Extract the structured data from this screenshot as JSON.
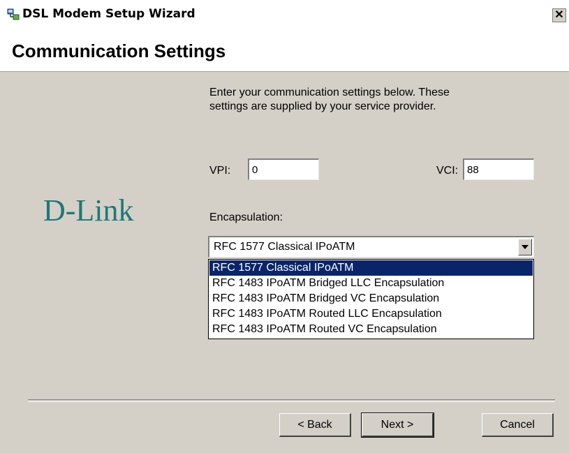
{
  "window": {
    "title": "DSL Modem Setup Wizard",
    "close_label": "✕"
  },
  "header": {
    "heading": "Communication Settings"
  },
  "logo": {
    "text": "D-Link"
  },
  "content": {
    "intro_line1": "Enter your communication settings below.  These",
    "intro_line2": "settings are supplied by your service provider.",
    "vpi_label": "VPI:",
    "vpi_value": "0",
    "vci_label": "VCI:",
    "vci_value": "88",
    "encapsulation_label": "Encapsulation:",
    "encapsulation_selected": "RFC 1577 Classical IPoATM",
    "encapsulation_options": [
      "RFC 1577 Classical IPoATM",
      "RFC 1483 IPoATM Bridged LLC Encapsulation",
      "RFC 1483 IPoATM Bridged VC Encapsulation",
      "RFC 1483 IPoATM Routed LLC Encapsulation",
      "RFC 1483 IPoATM Routed VC Encapsulation"
    ]
  },
  "buttons": {
    "back": "< Back",
    "next": "Next >",
    "cancel": "Cancel"
  },
  "colors": {
    "logo": "#1c7a75",
    "selection": "#0a246a",
    "dialog_face": "#d4d0c8"
  }
}
